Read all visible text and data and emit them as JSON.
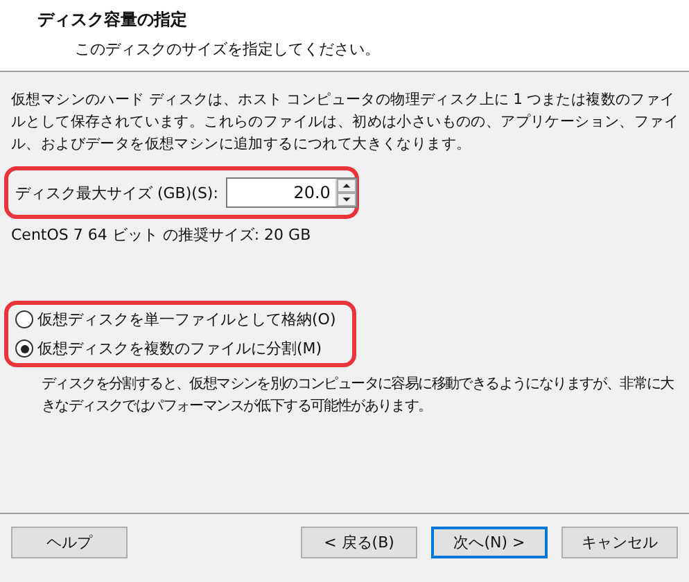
{
  "header": {
    "title": "ディスク容量の指定",
    "subtitle": "このディスクのサイズを指定してください。"
  },
  "description": "仮想マシンのハード ディスクは、ホスト コンピュータの物理ディスク上に 1 つまたは複数のファイルとして保存されています。これらのファイルは、初めは小さいものの、アプリケーション、ファイル、およびデータを仮想マシンに追加するにつれて大きくなります。",
  "disk_size": {
    "label": "ディスク最大サイズ (GB)(S):",
    "value": "20.0",
    "highlighted": true
  },
  "recommended": "CentOS 7 64 ビット の推奨サイズ: 20 GB",
  "storage": {
    "highlighted": true,
    "options": [
      {
        "label": "仮想ディスクを単一ファイルとして格納(O)",
        "selected": false
      },
      {
        "label": "仮想ディスクを複数のファイルに分割(M)",
        "selected": true
      }
    ]
  },
  "split_note": "ディスクを分割すると、仮想マシンを別のコンピュータに容易に移動できるようになりますが、非常に大きなディスクではパフォーマンスが低下する可能性があります。",
  "buttons": [
    {
      "label": "ヘルプ",
      "focused": false
    },
    {
      "label": "< 戻る(B)",
      "focused": false
    },
    {
      "label": "次へ(N) >",
      "focused": true
    },
    {
      "label": "キャンセル",
      "focused": false
    }
  ]
}
